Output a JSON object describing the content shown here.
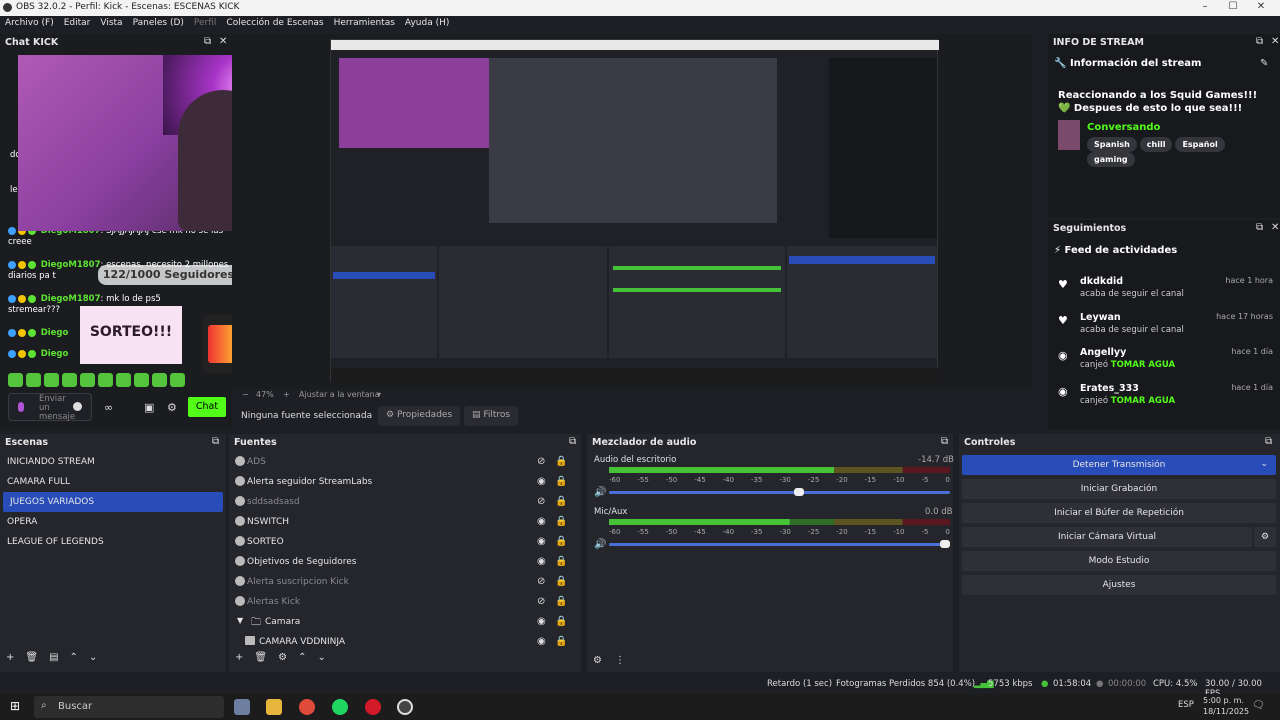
{
  "window": {
    "title": "OBS 32.0.2 - Perfil: Kick - Escenas: ESCENAS KICK",
    "controls": [
      "–",
      "☐",
      "✕"
    ]
  },
  "menu": [
    "Archivo (F)",
    "Editar",
    "Vista",
    "Paneles (D)",
    "Perfil",
    "Colección de Escenas",
    "Herramientas",
    "Ayuda (H)"
  ],
  "chat": {
    "title": "Chat KICK",
    "lines": [
      {
        "user": "DiegoM1807",
        "text": "SJAJJAJAJAJ ese mk no se las creee"
      },
      {
        "user": "DiegoM1807",
        "text": "escenas, necesito 2 millones diarios pa t"
      },
      {
        "user": "DiegoM1807",
        "text": "mk lo de ps5",
        "extra": "stremear???"
      },
      {
        "user": "Diego",
        "text": ""
      },
      {
        "user": "Diego",
        "text": ""
      }
    ],
    "left_fragments": [
      "do",
      "le"
    ],
    "goal": "122/1000 Seguidores!",
    "sorteo": "SORTEO!!!",
    "input_placeholder": "Enviar un mensaje",
    "send_label": "Chat"
  },
  "preview": {
    "zoom": "47%",
    "zoom_mode": "Ajustar a la ventana",
    "no_source": "Ninguna fuente seleccionada",
    "properties": "Propiedades",
    "filters": "Filtros"
  },
  "info_stream": {
    "panel_title": "INFO DE STREAM",
    "heading": "Información del stream",
    "title": "Reaccionando a los Squid Games!!! 💚 Despues de esto lo que sea!!!",
    "category": "Conversando",
    "tags": [
      "Spanish",
      "chill",
      "Español",
      "gaming"
    ]
  },
  "seguimientos": {
    "panel_title": "Seguimientos",
    "heading": "Feed de actividades",
    "items": [
      {
        "name": "dkdkdid",
        "desc": "acaba de seguir el canal",
        "reward": "",
        "time": "hace 1 hora",
        "icon": "♥"
      },
      {
        "name": "Leywan",
        "desc": "acaba de seguir el canal",
        "reward": "",
        "time": "hace 17 horas",
        "icon": "♥"
      },
      {
        "name": "Angellyy",
        "desc": "canjeó",
        "reward": "TOMAR AGUA",
        "time": "hace 1 día",
        "icon": "◉"
      },
      {
        "name": "Erates_333",
        "desc": "canjeó",
        "reward": "TOMAR AGUA",
        "time": "hace 1 día",
        "icon": "◉"
      }
    ]
  },
  "scenes": {
    "title": "Escenas",
    "items": [
      "INICIANDO STREAM",
      "CAMARA FULL",
      "JUEGOS VARIADOS",
      "OPERA",
      "LEAGUE OF LEGENDS"
    ],
    "selected": 2
  },
  "sources": {
    "title": "Fuentes",
    "items": [
      {
        "label": "ADS",
        "dim": true
      },
      {
        "label": "Alerta seguidor StreamLabs",
        "dim": false
      },
      {
        "label": "sddsadsasd",
        "dim": true
      },
      {
        "label": "NSWITCH",
        "dim": false
      },
      {
        "label": "SORTEO",
        "dim": false
      },
      {
        "label": "Objetivos de Seguidores",
        "dim": false
      },
      {
        "label": "Alerta suscripcion Kick",
        "dim": true
      },
      {
        "label": "Alertas Kick",
        "dim": true
      },
      {
        "label": "Camara",
        "dim": false
      },
      {
        "label": "CAMARA VDDNINJA",
        "dim": false
      }
    ]
  },
  "mixer": {
    "title": "Mezclador de audio",
    "scale": [
      "-60",
      "-55",
      "-50",
      "-45",
      "-40",
      "-35",
      "-30",
      "-25",
      "-20",
      "-15",
      "-10",
      "-5",
      "0"
    ],
    "channels": [
      {
        "name": "Audio del escritorio",
        "db": "-14.7 dB",
        "level": 0.66,
        "volume": 0.56
      },
      {
        "name": "Mic/Aux",
        "db": "0.0 dB",
        "level": 0.53,
        "volume": 1.0
      }
    ]
  },
  "controls": {
    "title": "Controles",
    "buttons": [
      "Detener Transmisión",
      "Iniciar Grabación",
      "Iniciar el Búfer de Repetición",
      "Iniciar Cámara Virtual",
      "Modo Estudio",
      "Ajustes"
    ]
  },
  "status": {
    "delay": "Retardo (1 sec)",
    "dropped": "Fotogramas Perdidos 854 (0.4%)",
    "bitrate": "5753 kbps",
    "live_time": "01:58:04",
    "rec_time": "00:00:00",
    "cpu": "CPU: 4.5%",
    "fps": "30.00 / 30.00 FPS"
  },
  "taskbar": {
    "search": "Buscar",
    "lang": "ESP",
    "time": "5:00 p. m.",
    "date": "18/11/2025"
  }
}
